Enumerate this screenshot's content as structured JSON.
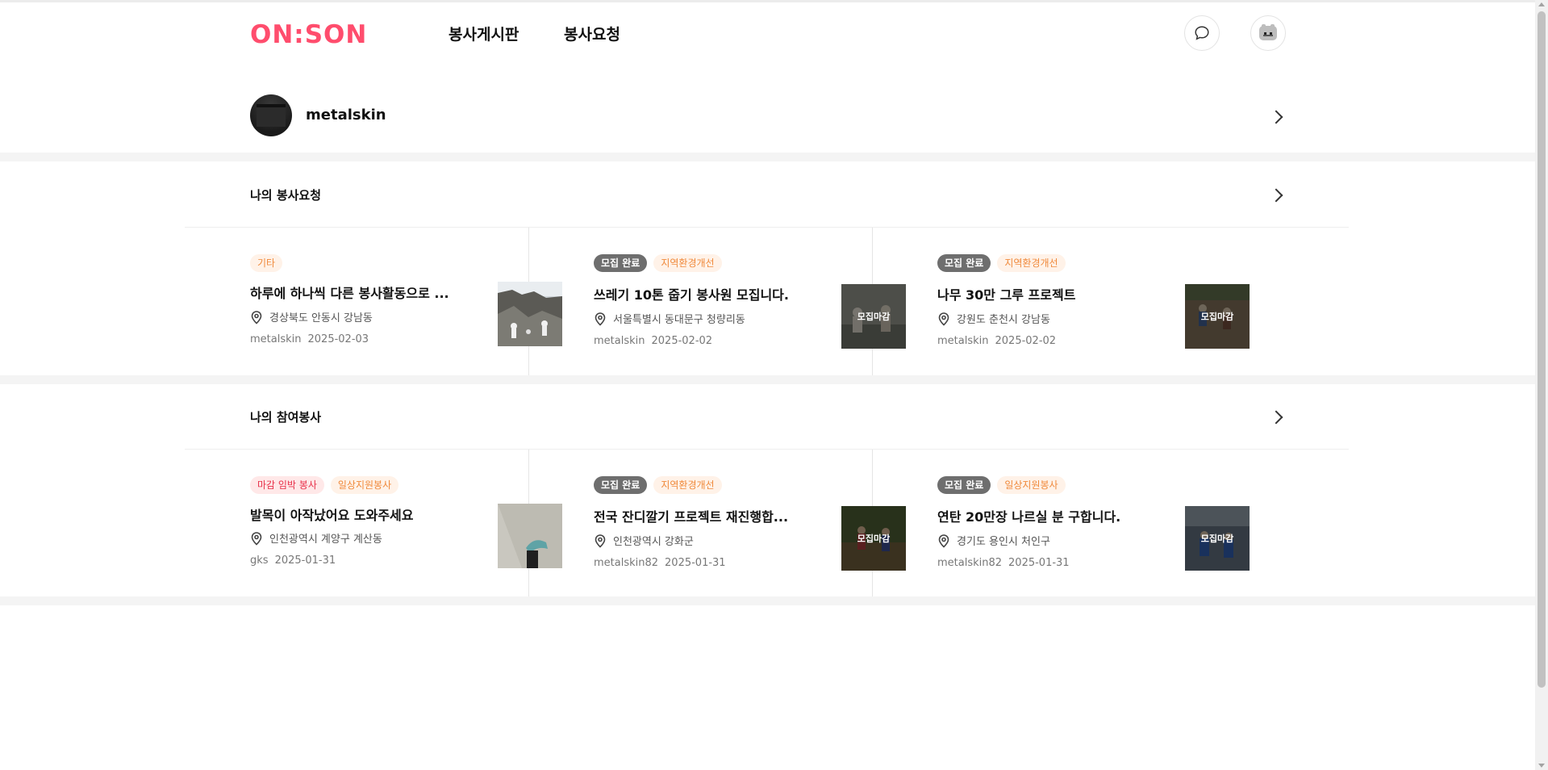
{
  "brand": {
    "logo_text": "ON:SON",
    "accent_color": "#ff4d6d"
  },
  "nav": {
    "items": [
      {
        "label": "봉사게시판"
      },
      {
        "label": "봉사요청"
      }
    ]
  },
  "header_icons": {
    "chat": "chat-bubble-icon",
    "avatar": "user-avatar-icon"
  },
  "profile": {
    "username": "metalskin"
  },
  "sections": [
    {
      "title": "나의 봉사요청",
      "cards": [
        {
          "tags": [
            {
              "text": "기타",
              "kind": "category"
            }
          ],
          "title": "하루에 하나씩 다른 봉사활동으로 ...",
          "location": "경상북도 안동시 강남동",
          "author": "metalskin",
          "date": "2025-02-03",
          "closed": false,
          "overlay_text": ""
        },
        {
          "tags": [
            {
              "text": "모집 완료",
              "kind": "done"
            },
            {
              "text": "지역환경개선",
              "kind": "category"
            }
          ],
          "title": "쓰레기 10톤 줍기 봉사원 모집니다.",
          "location": "서울특별시 동대문구 청량리동",
          "author": "metalskin",
          "date": "2025-02-02",
          "closed": true,
          "overlay_text": "모집마감"
        },
        {
          "tags": [
            {
              "text": "모집 완료",
              "kind": "done"
            },
            {
              "text": "지역환경개선",
              "kind": "category"
            }
          ],
          "title": "나무 30만 그루 프로젝트",
          "location": "강원도 춘천시 강남동",
          "author": "metalskin",
          "date": "2025-02-02",
          "closed": true,
          "overlay_text": "모집마감"
        }
      ]
    },
    {
      "title": "나의 참여봉사",
      "cards": [
        {
          "tags": [
            {
              "text": "마감 임박 봉사",
              "kind": "urgent"
            },
            {
              "text": "일상지원봉사",
              "kind": "category"
            }
          ],
          "title": "발목이 아작났어요 도와주세요",
          "location": "인천광역시 계양구 계산동",
          "author": "gks",
          "date": "2025-01-31",
          "closed": false,
          "overlay_text": ""
        },
        {
          "tags": [
            {
              "text": "모집 완료",
              "kind": "done"
            },
            {
              "text": "지역환경개선",
              "kind": "category"
            }
          ],
          "title": "전국 잔디깔기 프로젝트 재진행합...",
          "location": "인천광역시 강화군",
          "author": "metalskin82",
          "date": "2025-01-31",
          "closed": true,
          "overlay_text": "모집마감"
        },
        {
          "tags": [
            {
              "text": "모집 완료",
              "kind": "done"
            },
            {
              "text": "일상지원봉사",
              "kind": "category"
            }
          ],
          "title": "연탄 20만장 나르실 분 구합니다.",
          "location": "경기도 용인시 처인구",
          "author": "metalskin82",
          "date": "2025-01-31",
          "closed": true,
          "overlay_text": "모집마감"
        }
      ]
    }
  ]
}
